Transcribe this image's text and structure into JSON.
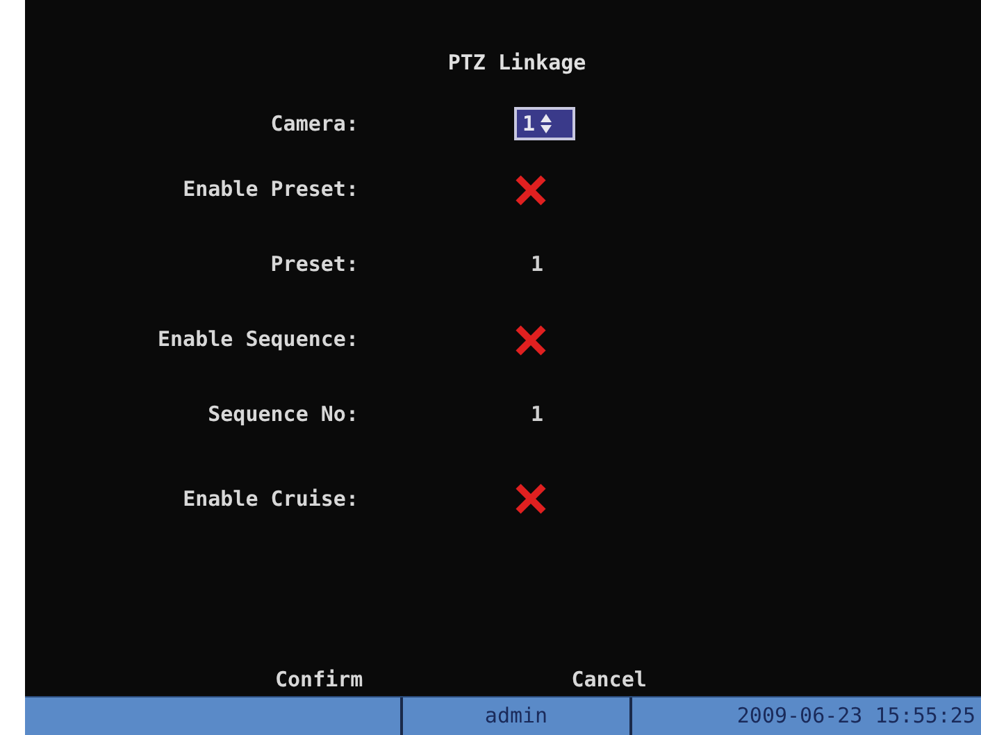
{
  "title": "PTZ Linkage",
  "fields": [
    {
      "kind": "spinner",
      "label": "Camera:",
      "value": "1"
    },
    {
      "kind": "toggle",
      "label": "Enable Preset:",
      "enabled": false
    },
    {
      "kind": "value",
      "label": "Preset:",
      "value": "1"
    },
    {
      "kind": "toggle",
      "label": "Enable Sequence:",
      "enabled": false
    },
    {
      "kind": "value",
      "label": "Sequence No:",
      "value": "1"
    },
    {
      "kind": "toggle",
      "label": "Enable Cruise:",
      "enabled": false
    }
  ],
  "buttons": [
    "Confirm",
    "Cancel"
  ],
  "status_bar": {
    "user": "admin",
    "datetime": "2009-06-23 15:55:25"
  }
}
